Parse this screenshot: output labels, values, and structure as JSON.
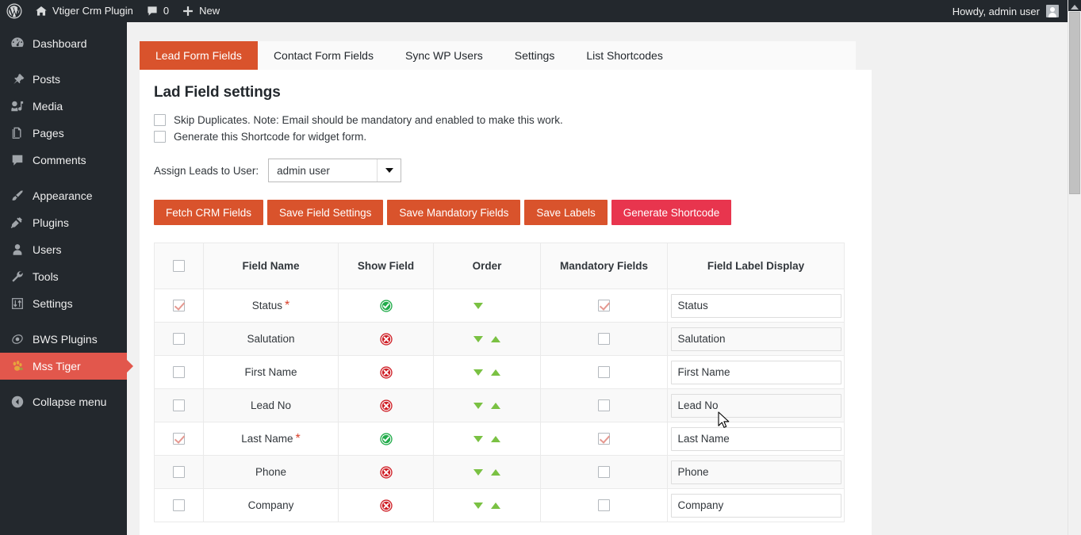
{
  "adminbar": {
    "wp_logo": "wordpress-logo-icon",
    "site_name": "Vtiger Crm Plugin",
    "comments_count": "0",
    "new_label": "New",
    "howdy": "Howdy, admin user"
  },
  "sidebar": {
    "items": [
      {
        "label": "Dashboard",
        "icon": "dashboard-icon",
        "current": false
      },
      {
        "label": "Posts",
        "icon": "posts-pin-icon",
        "current": false
      },
      {
        "label": "Media",
        "icon": "media-icon",
        "current": false
      },
      {
        "label": "Pages",
        "icon": "pages-icon",
        "current": false
      },
      {
        "label": "Comments",
        "icon": "comments-icon",
        "current": false
      },
      {
        "label": "Appearance",
        "icon": "appearance-brush-icon",
        "current": false
      },
      {
        "label": "Plugins",
        "icon": "plugins-plug-icon",
        "current": false
      },
      {
        "label": "Users",
        "icon": "users-icon",
        "current": false
      },
      {
        "label": "Tools",
        "icon": "tools-wrench-icon",
        "current": false
      },
      {
        "label": "Settings",
        "icon": "settings-sliders-icon",
        "current": false
      },
      {
        "label": "BWS Plugins",
        "icon": "bws-plugins-icon",
        "current": false
      },
      {
        "label": "Mss Tiger",
        "icon": "tiger-paw-icon",
        "current": true
      },
      {
        "label": "Collapse menu",
        "icon": "collapse-arrow-icon",
        "current": false
      }
    ]
  },
  "tabs": [
    {
      "label": "Lead Form Fields",
      "active": true
    },
    {
      "label": "Contact Form Fields",
      "active": false
    },
    {
      "label": "Sync WP Users",
      "active": false
    },
    {
      "label": "Settings",
      "active": false
    },
    {
      "label": "List Shortcodes",
      "active": false
    }
  ],
  "main": {
    "title": "Lad Field settings",
    "options": [
      {
        "label": "Skip Duplicates. Note: Email should be mandatory and enabled to make this work.",
        "checked": false
      },
      {
        "label": "Generate this Shortcode for widget form.",
        "checked": false
      }
    ],
    "assign": {
      "label": "Assign Leads to User:",
      "value": "admin user",
      "arrow_icon": "chevron-down-icon"
    },
    "buttons": [
      {
        "label": "Fetch CRM Fields",
        "style": "primary"
      },
      {
        "label": "Save Field Settings",
        "style": "primary"
      },
      {
        "label": "Save Mandatory Fields",
        "style": "primary"
      },
      {
        "label": "Save Labels",
        "style": "primary"
      },
      {
        "label": "Generate Shortcode",
        "style": "danger"
      }
    ],
    "table": {
      "headers": [
        "",
        "Field Name",
        "Show Field",
        "Order",
        "Mandatory Fields",
        "Field Label Display"
      ],
      "select_all_checked": false,
      "rows": [
        {
          "selected": true,
          "name": "Status",
          "required": true,
          "show": "enabled",
          "order_down": true,
          "order_up": false,
          "mandatory": true,
          "label_value": "Status"
        },
        {
          "selected": false,
          "name": "Salutation",
          "required": false,
          "show": "disabled",
          "order_down": true,
          "order_up": true,
          "mandatory": false,
          "label_value": "Salutation"
        },
        {
          "selected": false,
          "name": "First Name",
          "required": false,
          "show": "disabled",
          "order_down": true,
          "order_up": true,
          "mandatory": false,
          "label_value": "First Name"
        },
        {
          "selected": false,
          "name": "Lead No",
          "required": false,
          "show": "disabled",
          "order_down": true,
          "order_up": true,
          "mandatory": false,
          "label_value": "Lead No"
        },
        {
          "selected": true,
          "name": "Last Name",
          "required": true,
          "show": "enabled",
          "order_down": true,
          "order_up": true,
          "mandatory": true,
          "label_value": "Last Name"
        },
        {
          "selected": false,
          "name": "Phone",
          "required": false,
          "show": "disabled",
          "order_down": true,
          "order_up": true,
          "mandatory": false,
          "label_value": "Phone"
        },
        {
          "selected": false,
          "name": "Company",
          "required": false,
          "show": "disabled",
          "order_down": true,
          "order_up": true,
          "mandatory": false,
          "label_value": "Company"
        }
      ]
    }
  },
  "colors": {
    "admin_dark": "#23282d",
    "accent_orange": "#d9532c",
    "accent_red": "#e8354e",
    "current_menu": "#e2574c",
    "status_enabled_green": "#22ac4b",
    "status_disabled_red": "#cf2027",
    "order_arrow_green": "#7ac143"
  },
  "scrollbar": {
    "position": "top",
    "up_arrow_icon": "scroll-up-arrow-icon"
  }
}
